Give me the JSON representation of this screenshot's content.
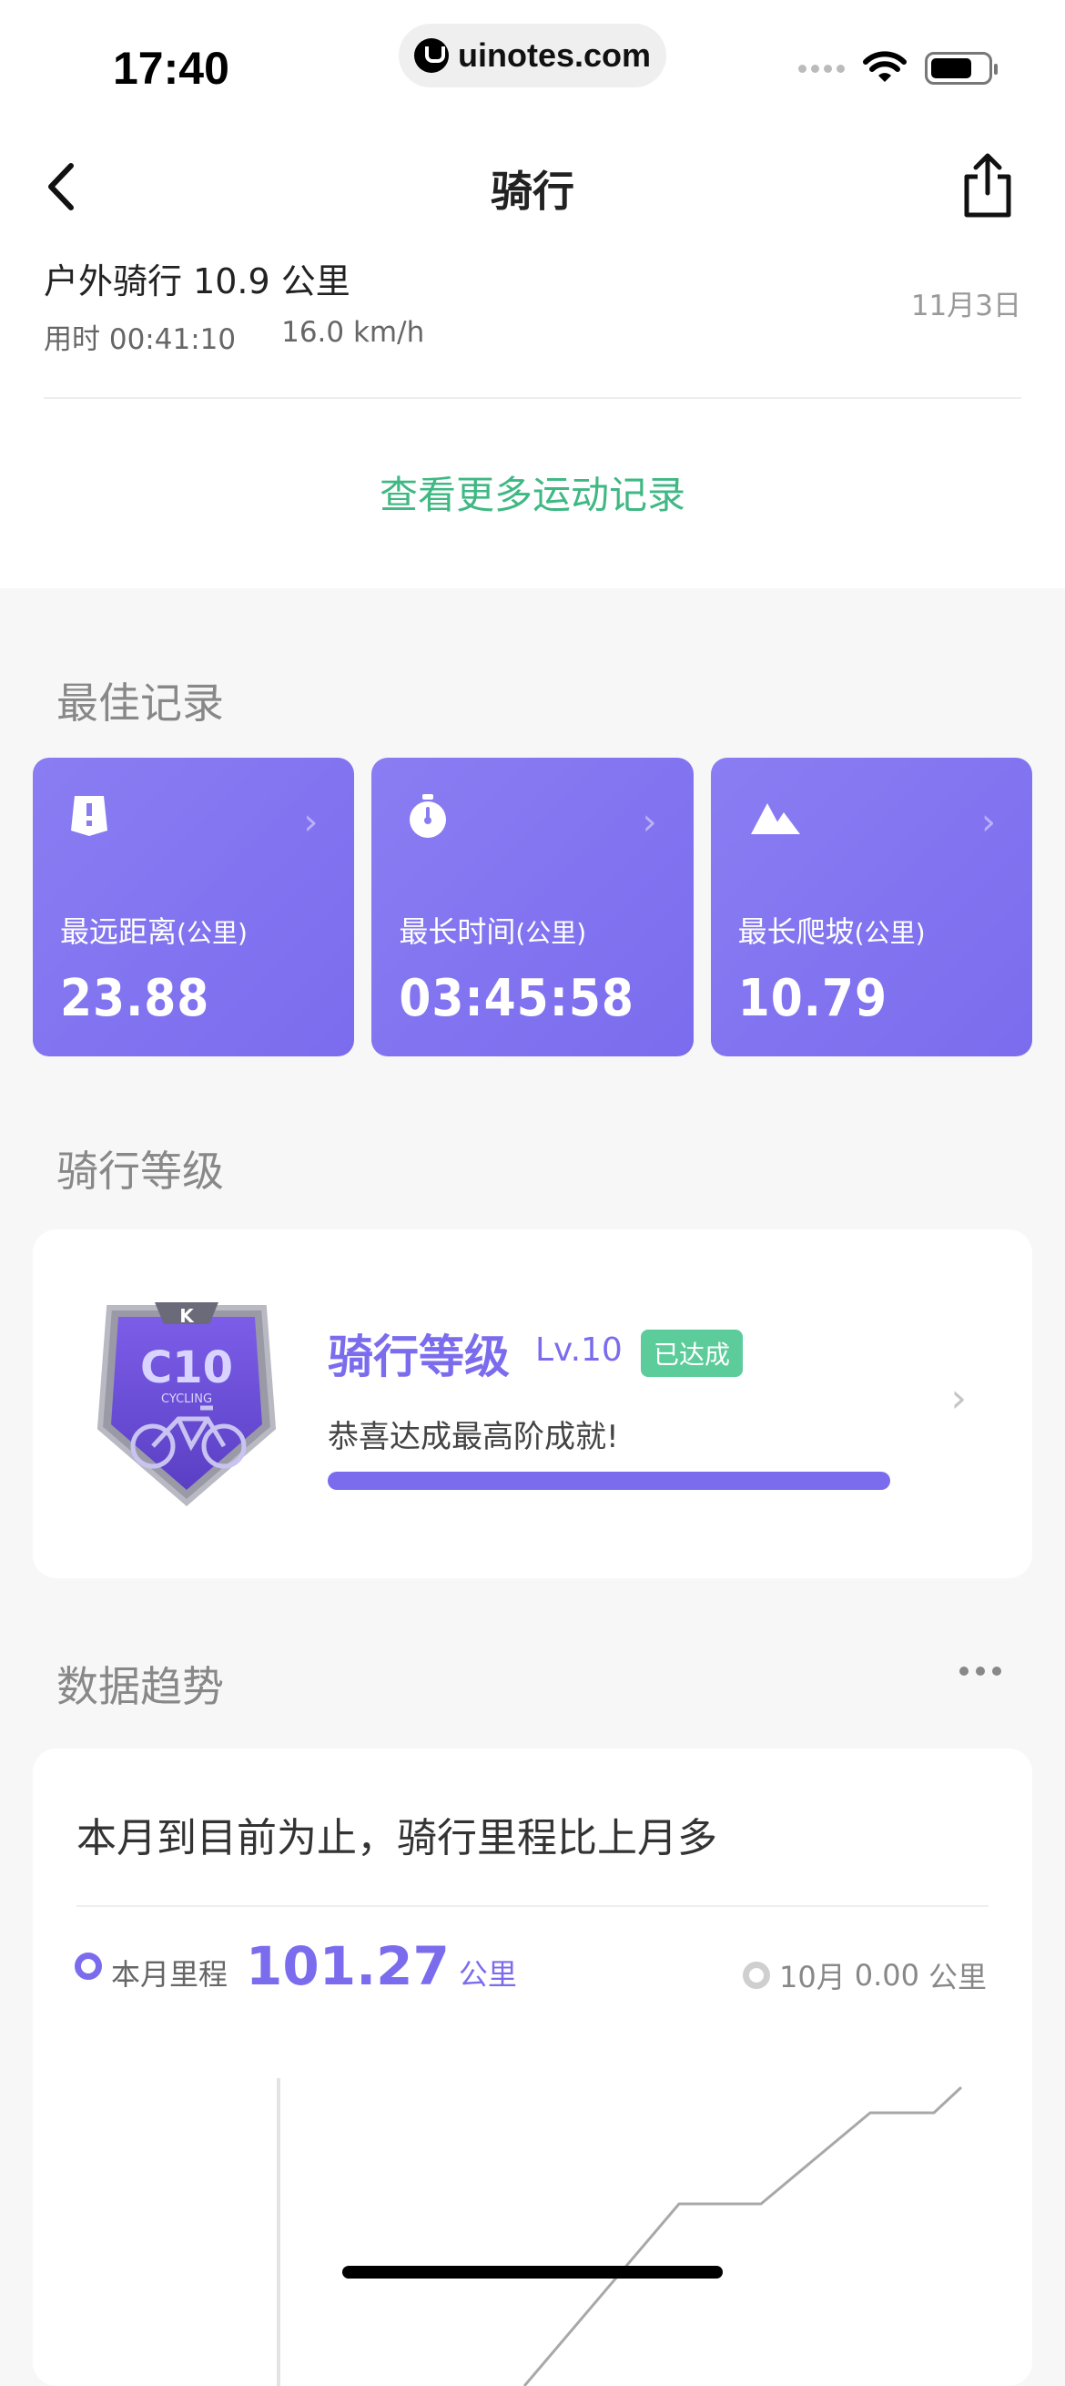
{
  "status_bar": {
    "time": "17:40",
    "url": "uinotes.com"
  },
  "nav": {
    "title": "骑行"
  },
  "record": {
    "title": "户外骑行 10.9 公里",
    "duration": "用时 00:41:10",
    "speed": "16.0 km/h",
    "date": "11月3日"
  },
  "more_records_link": "查看更多运动记录",
  "best": {
    "section_title": "最佳记录",
    "cards": [
      {
        "label": "最远距离",
        "unit": "(公里)",
        "value": "23.88",
        "icon": "distance-icon"
      },
      {
        "label": "最长时间",
        "unit": "(公里)",
        "value": "03:45:58",
        "icon": "stopwatch-icon"
      },
      {
        "label": "最长爬坡",
        "unit": "(公里)",
        "value": "10.79",
        "icon": "mountain-icon"
      }
    ]
  },
  "level": {
    "section_title": "骑行等级",
    "badge_text": "C10",
    "badge_sub": "CYCLING",
    "badge_corner": "K",
    "title": "骑行等级",
    "lv": "Lv.10",
    "tag": "已达成",
    "desc": "恭喜达成最高阶成就!",
    "progress": 1.0
  },
  "trend": {
    "section_title": "数据趋势",
    "headline": "本月到目前为止，骑行里程比上月多",
    "this_month_label": "本月里程",
    "this_month_value": "101.27",
    "this_month_unit": "公里",
    "prev_month_label": "10月",
    "prev_month_value": "0.00",
    "prev_month_unit": "公里"
  },
  "colors": {
    "accent": "#7b6cee",
    "green": "#3fb883",
    "tag_green": "#5ccc9a"
  }
}
